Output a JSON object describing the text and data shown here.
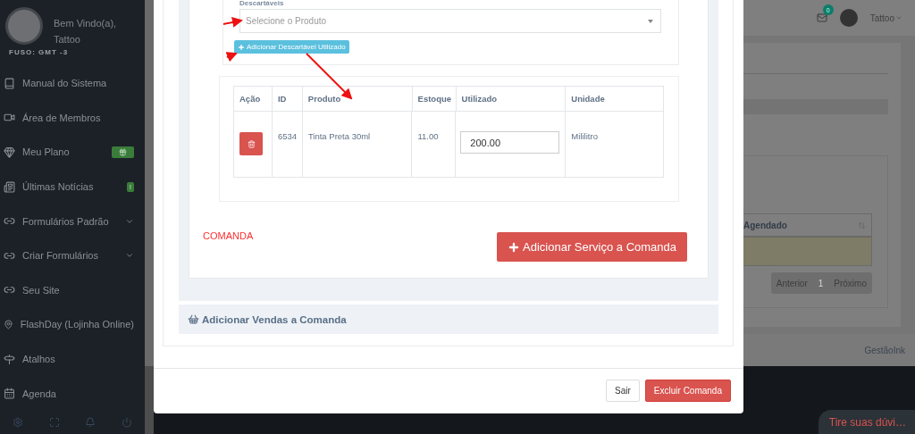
{
  "sidebar": {
    "greeting": "Bem Vindo(a),",
    "user": "Tattoo",
    "timezone": "FUSO: GMT -3",
    "items": [
      {
        "label": "Manual do Sistema",
        "expandable": false
      },
      {
        "label": "Área de Membros",
        "expandable": false
      },
      {
        "label": "Meu Plano",
        "expandable": false,
        "badge": {
          "kind": "gift"
        }
      },
      {
        "label": "Últimas Notícias",
        "expandable": false,
        "badge": {
          "kind": "text",
          "text": "!"
        }
      },
      {
        "label": "Formulários Padrão",
        "expandable": true
      },
      {
        "label": "Criar Formulários",
        "expandable": true
      },
      {
        "label": "Seu Site",
        "expandable": false
      },
      {
        "label": "FlashDay (Lojinha Online)",
        "expandable": false
      },
      {
        "label": "Atalhos",
        "expandable": false
      },
      {
        "label": "Agenda",
        "expandable": false
      }
    ]
  },
  "header": {
    "notifications": "0",
    "user": "Tattoo"
  },
  "background_table": {
    "columns": [
      "Agendado"
    ],
    "pagination": [
      {
        "label": "Anterior",
        "selected": false
      },
      {
        "label": "1",
        "selected": true
      },
      {
        "label": "Próximo",
        "selected": false
      }
    ]
  },
  "footer": "GestãoInk",
  "chat_button": "Tire suas dúvi…",
  "modal": {
    "section_title": "Descartáveis",
    "product_select": {
      "placeholder": "Selecione o Produto"
    },
    "add_disposable_button": "Adicionar Descartável Utilizado",
    "table": {
      "columns": [
        "Ação",
        "ID",
        "Produto",
        "Estoque",
        "Utilizado",
        "Unidade"
      ],
      "rows": [
        {
          "id": "6534",
          "product": "Tinta Preta 30ml",
          "stock": "11.00",
          "used": "200.00",
          "unit": "Mililitro"
        }
      ]
    },
    "annotation": "COMANDA",
    "add_service_button": "Adicionar Serviço a Comanda",
    "sales_section": "Adicionar Vendas a Comanda",
    "buttons": [
      {
        "label": "Sair",
        "kind": "default"
      },
      {
        "label": "Excluir Comanda",
        "kind": "danger"
      }
    ]
  }
}
